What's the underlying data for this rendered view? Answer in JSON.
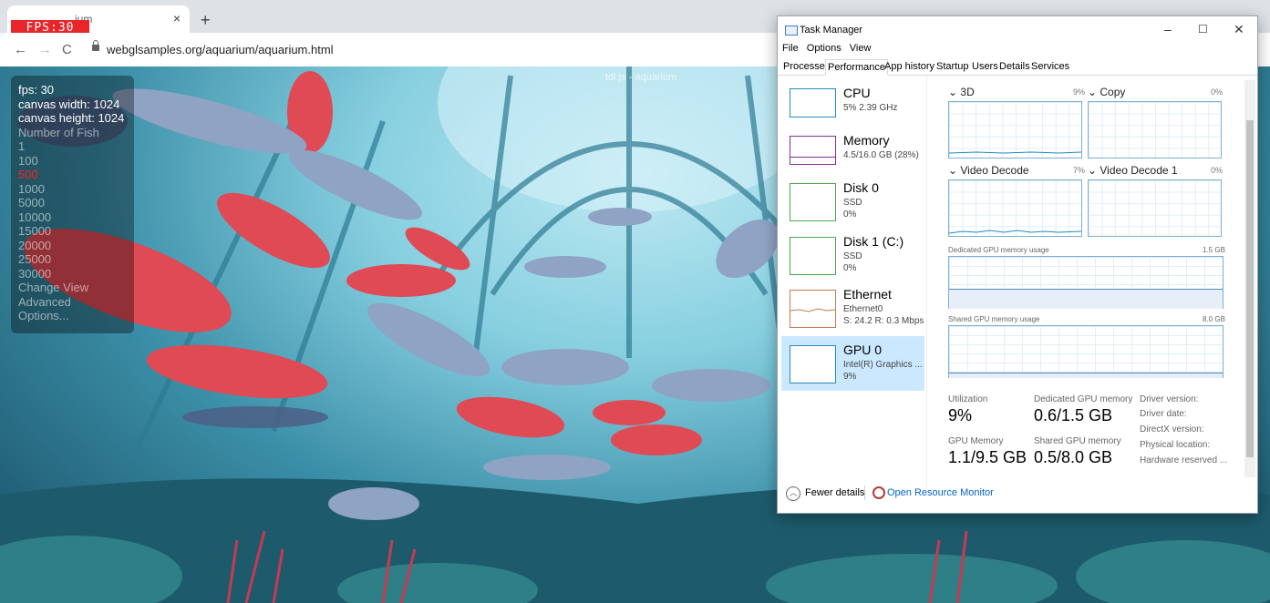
{
  "browser": {
    "fps_overlay": "FPS:30",
    "tab_title": "ium",
    "tab_close": "×",
    "new_tab": "+",
    "back": "←",
    "forward": "→",
    "reload": "C",
    "url": "webglsamples.org/aquarium/aquarium.html"
  },
  "aquarium": {
    "title": "tdl.js - aquarium",
    "fps": "fps: 30",
    "canvas_width": "canvas width: 1024",
    "canvas_height": "canvas height: 1024",
    "number_of_fish_label": "Number of Fish",
    "fish_options": [
      "1",
      "100",
      "500",
      "1000",
      "5000",
      "10000",
      "15000",
      "20000",
      "25000",
      "30000"
    ],
    "selected_fish_option": "500",
    "change_view": "Change View",
    "advanced": "Advanced",
    "options": "Options..."
  },
  "task_manager": {
    "title": "Task Manager",
    "window_buttons": {
      "minimize": "–",
      "maximize": "☐",
      "close": "✕"
    },
    "menu": [
      "File",
      "Options",
      "View"
    ],
    "tabs": [
      "Processes",
      "Performance",
      "App history",
      "Startup",
      "Users",
      "Details",
      "Services"
    ],
    "active_tab": "Performance",
    "resources": [
      {
        "name": "CPU",
        "lines": [
          "5% 2.39 GHz"
        ],
        "color": "#1e8bc3"
      },
      {
        "name": "Memory",
        "lines": [
          "4.5/16.0 GB (28%)"
        ],
        "color": "#8b2a9c"
      },
      {
        "name": "Disk 0",
        "lines": [
          "SSD",
          "0%"
        ],
        "color": "#4da84d"
      },
      {
        "name": "Disk 1 (C:)",
        "lines": [
          "SSD",
          "0%"
        ],
        "color": "#4da84d"
      },
      {
        "name": "Ethernet",
        "lines": [
          "Ethernet0",
          "S: 24.2 R: 0.3 Mbps"
        ],
        "color": "#c47a4d"
      },
      {
        "name": "GPU 0",
        "lines": [
          "Intel(R) Graphics ...",
          "9%"
        ],
        "color": "#1e8bc3"
      }
    ],
    "engines": [
      {
        "name": "3D",
        "pct": "9%"
      },
      {
        "name": "Copy",
        "pct": "0%"
      },
      {
        "name": "Video Decode",
        "pct": "7%"
      },
      {
        "name": "Video Decode 1",
        "pct": "0%"
      }
    ],
    "dedicated_label": "Dedicated GPU memory usage",
    "dedicated_max": "1.5 GB",
    "shared_label": "Shared GPU memory usage",
    "shared_max": "8.0 GB",
    "stats": {
      "utilization_label": "Utilization",
      "utilization": "9%",
      "dedicated_label": "Dedicated GPU memory",
      "dedicated": "0.6/1.5 GB",
      "gpu_memory_label": "GPU Memory",
      "gpu_memory": "1.1/9.5 GB",
      "shared_label": "Shared GPU memory",
      "shared": "0.5/8.0 GB"
    },
    "driver_labels": [
      "Driver version:",
      "Driver date:",
      "DirectX version:",
      "Physical location:",
      "Hardware reserved ..."
    ],
    "footer": {
      "fewer_details": "Fewer details",
      "open_monitor": "Open Resource Monitor"
    }
  }
}
